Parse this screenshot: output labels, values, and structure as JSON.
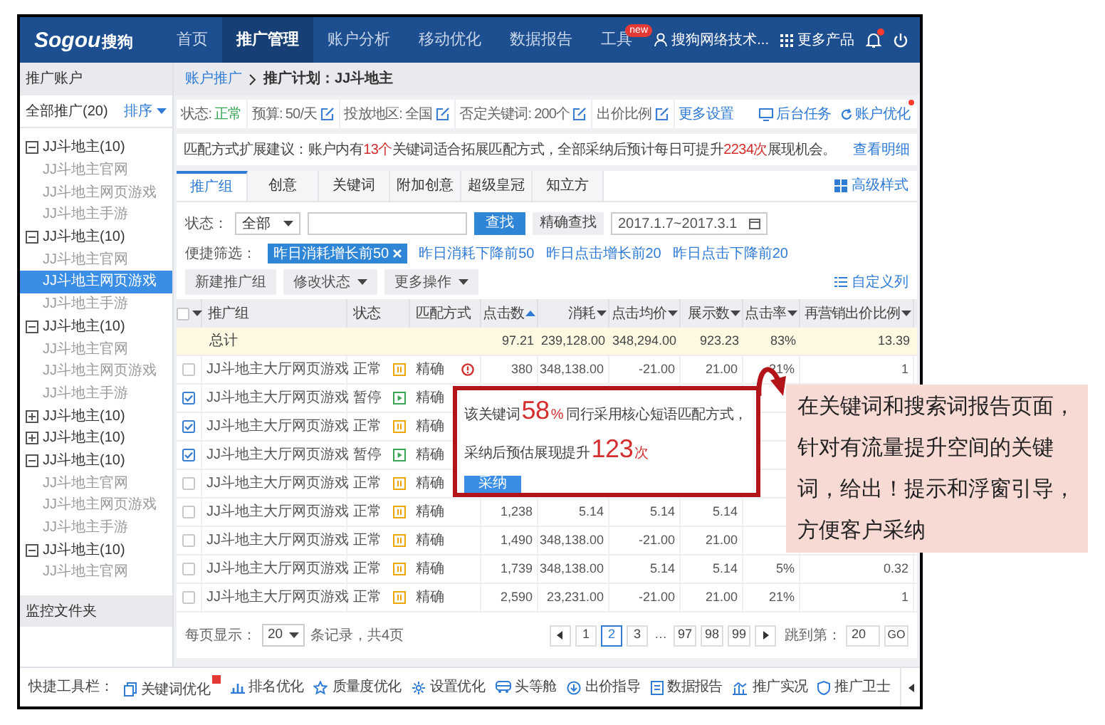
{
  "nav": {
    "logo": "Sogou",
    "logo_cn": "搜狗",
    "items": [
      {
        "label": "首页",
        "selected": false
      },
      {
        "label": "推广管理",
        "selected": true
      },
      {
        "label": "账户分析",
        "selected": false
      },
      {
        "label": "移动优化",
        "selected": false
      },
      {
        "label": "数据报告",
        "selected": false
      },
      {
        "label": "工具",
        "selected": false,
        "badge": "new"
      }
    ],
    "user": "搜狗网络技术...",
    "more_products": "更多产品",
    "notification_dot": true
  },
  "sidebar": {
    "title": "推广账户",
    "all_label": "全部推广(20)",
    "sort": "排序",
    "tree": [
      {
        "label": "JJ斗地主(10)",
        "expanded": true,
        "children": [
          {
            "label": "JJ斗地主官网",
            "selected": false
          },
          {
            "label": "JJ斗地主网页游戏",
            "selected": false
          },
          {
            "label": "JJ斗地主手游",
            "selected": false
          }
        ]
      },
      {
        "label": "JJ斗地主(10)",
        "expanded": true,
        "children": [
          {
            "label": "JJ斗地主官网",
            "selected": false
          },
          {
            "label": "JJ斗地主网页游戏",
            "selected": true
          },
          {
            "label": "JJ斗地主手游",
            "selected": false
          }
        ]
      },
      {
        "label": "JJ斗地主(10)",
        "expanded": true,
        "children": [
          {
            "label": "JJ斗地主官网",
            "selected": false
          },
          {
            "label": "JJ斗地主网页游戏",
            "selected": false
          },
          {
            "label": "JJ斗地主手游",
            "selected": false
          }
        ]
      },
      {
        "label": "JJ斗地主(10)",
        "expanded": false
      },
      {
        "label": "JJ斗地主(10)",
        "expanded": false
      },
      {
        "label": "JJ斗地主(10)",
        "expanded": true,
        "children": [
          {
            "label": "JJ斗地主官网",
            "selected": false
          },
          {
            "label": "JJ斗地主网页游戏",
            "selected": false
          },
          {
            "label": "JJ斗地主手游",
            "selected": false
          }
        ]
      },
      {
        "label": "JJ斗地主(10)",
        "expanded": true,
        "children": [
          {
            "label": "JJ斗地主官网",
            "selected": false
          }
        ]
      }
    ],
    "folder": "监控文件夹"
  },
  "breadcrumb": {
    "link": "账户推广",
    "current": "推广计划：JJ斗地主"
  },
  "plan_info": {
    "fields": [
      {
        "label": "状态:",
        "value": "正常",
        "editable": false
      },
      {
        "label": "预算:",
        "value": "50/天",
        "editable": true
      },
      {
        "label": "投放地区:",
        "value": "全国",
        "editable": true
      },
      {
        "label": "否定关键词:",
        "value": "200个",
        "editable": true
      },
      {
        "label": "出价比例",
        "editable": true
      }
    ],
    "more": "更多设置",
    "actions": [
      {
        "label": "后台任务",
        "dot": false
      },
      {
        "label": "账户优化",
        "dot": true
      }
    ]
  },
  "suggestion": {
    "parts": [
      {
        "text": "匹配方式扩展建议：账户内有",
        "highlight": false
      },
      {
        "text": "13个",
        "highlight": true
      },
      {
        "text": "关键词适合拓展匹配方式，全部采纳后预计每日可提升",
        "highlight": false
      },
      {
        "text": "2234次",
        "highlight": true
      },
      {
        "text": "展现机会。",
        "highlight": false
      }
    ],
    "link": "查看明细"
  },
  "tabs": [
    {
      "label": "推广组",
      "selected": true
    },
    {
      "label": "创意",
      "selected": false
    },
    {
      "label": "关键词",
      "selected": false
    },
    {
      "label": "附加创意",
      "selected": false
    },
    {
      "label": "超级皇冠",
      "selected": false
    },
    {
      "label": "知立方",
      "selected": false
    }
  ],
  "style_link": "高级样式",
  "filters": {
    "status_label": "状态：",
    "status_value": "全部",
    "search_button": "查找",
    "exact_button": "精确查找",
    "date_range": "2017.1.7~2017.3.1"
  },
  "quick_filters": {
    "label": "便捷筛选：",
    "items": [
      {
        "label": "昨日消耗增长前50",
        "selected": true
      },
      {
        "label": "昨日消耗下降前50",
        "selected": false
      },
      {
        "label": "昨日点击增长前20",
        "selected": false
      },
      {
        "label": "昨日点击下降前20",
        "selected": false
      }
    ]
  },
  "actions": [
    {
      "label": "新建推广组",
      "dropdown": false
    },
    {
      "label": "修改状态",
      "dropdown": true
    },
    {
      "label": "更多操作",
      "dropdown": true
    }
  ],
  "custom_columns": "自定义列",
  "table": {
    "select_all_checked": false,
    "columns": [
      {
        "label": "推广组",
        "sortable": false
      },
      {
        "label": "状态",
        "sortable": false
      },
      {
        "label": "匹配方式",
        "sortable": false
      },
      {
        "label": "点击数",
        "sorted": true
      },
      {
        "label": "消耗",
        "sortable": true,
        "sorted": false
      },
      {
        "label": "点击均价",
        "sortable": true,
        "sorted": false
      },
      {
        "label": "展示数",
        "sortable": true,
        "sorted": false
      },
      {
        "label": "点击率",
        "sortable": true,
        "sorted": false
      },
      {
        "label": "再营销出价比例",
        "sortable": true,
        "sorted": false
      }
    ],
    "total": {
      "label": "总计",
      "values": [
        "97.21",
        "239,128.00",
        "348,294.00",
        "923.23",
        "83%",
        "13.39"
      ]
    },
    "rows": [
      {
        "checked": false,
        "name": "JJ斗地主大厅网页游戏",
        "status": "正常",
        "paused": false,
        "match": "精确",
        "warning": true,
        "values": [
          "380",
          "348,138.00",
          "-21.00",
          "21.00",
          "21%",
          "1"
        ]
      },
      {
        "checked": true,
        "name": "JJ斗地主大厅网页游戏",
        "status": "暂停",
        "paused": true,
        "match": "精确",
        "warning": false,
        "values": []
      },
      {
        "checked": true,
        "name": "JJ斗地主大厅网页游戏",
        "status": "正常",
        "paused": false,
        "match": "精确",
        "warning": false,
        "values": []
      },
      {
        "checked": true,
        "name": "JJ斗地主大厅网页游戏",
        "status": "暂停",
        "paused": true,
        "match": "精确",
        "warning": false,
        "values": []
      },
      {
        "checked": false,
        "name": "JJ斗地主大厅网页游戏",
        "status": "正常",
        "paused": false,
        "match": "精确",
        "warning": false,
        "values": []
      },
      {
        "checked": false,
        "name": "JJ斗地主大厅网页游戏",
        "status": "正常",
        "paused": false,
        "match": "精确",
        "warning": false,
        "values": [
          "1,238",
          "5.14",
          "5.14",
          "5.14"
        ]
      },
      {
        "checked": false,
        "name": "JJ斗地主大厅网页游戏",
        "status": "正常",
        "paused": false,
        "match": "精确",
        "warning": false,
        "values": [
          "1,490",
          "348,138.00",
          "-21.00",
          "21.00"
        ]
      },
      {
        "checked": false,
        "name": "JJ斗地主大厅网页游戏",
        "status": "正常",
        "paused": false,
        "match": "精确",
        "warning": false,
        "values": [
          "1,739",
          "348,138.00",
          "5.14",
          "5.14",
          "5%",
          "0.32"
        ]
      },
      {
        "checked": false,
        "name": "JJ斗地主大厅网页游戏",
        "status": "正常",
        "paused": false,
        "match": "精确",
        "warning": false,
        "values": [
          "2,590",
          "23,231.00",
          "-21.00",
          "21.00",
          "21%",
          "1"
        ]
      }
    ]
  },
  "popup": {
    "lines": [
      [
        {
          "text": "该关键词",
          "kind": "plain"
        },
        {
          "text": "58",
          "kind": "big"
        },
        {
          "text": "%",
          "kind": "unit"
        },
        {
          "text": "同行采用核心短语匹配方式，",
          "kind": "plain"
        }
      ],
      [
        {
          "text": "采纳后预估展现提升",
          "kind": "plain"
        },
        {
          "text": "123",
          "kind": "big"
        },
        {
          "text": "次",
          "kind": "unit"
        }
      ]
    ],
    "button": "采纳"
  },
  "pagination": {
    "per_page_label": "每页显示：",
    "per_page": "20",
    "summary": "条记录，共4页",
    "pages": [
      {
        "label": "1",
        "kind": "page",
        "selected": false
      },
      {
        "label": "2",
        "kind": "page",
        "selected": true
      },
      {
        "label": "3",
        "kind": "page",
        "selected": false
      },
      {
        "label": "…",
        "kind": "ellipsis",
        "selected": false
      },
      {
        "label": "97",
        "kind": "page",
        "selected": false
      },
      {
        "label": "98",
        "kind": "page",
        "selected": false
      },
      {
        "label": "99",
        "kind": "page",
        "selected": false
      }
    ],
    "jump_label": "跳到第：",
    "jump_value": "20",
    "go": "GO"
  },
  "toolbar": {
    "label": "快捷工具栏：",
    "items": [
      {
        "label": "关键词优化",
        "badge": true
      },
      {
        "label": "排名优化",
        "badge": false
      },
      {
        "label": "质量度优化",
        "badge": false
      },
      {
        "label": "设置优化",
        "badge": false
      },
      {
        "label": "头等舱",
        "badge": false
      },
      {
        "label": "出价指导",
        "badge": false
      },
      {
        "label": "数据报告",
        "badge": false
      },
      {
        "label": "推广实况",
        "badge": false
      },
      {
        "label": "推广卫士",
        "badge": false
      }
    ]
  },
  "callout": {
    "text": "在关键词和搜索词报告页面，针对有流量提升空间的关键词，给出！提示和浮窗引导，方便客户采纳"
  }
}
